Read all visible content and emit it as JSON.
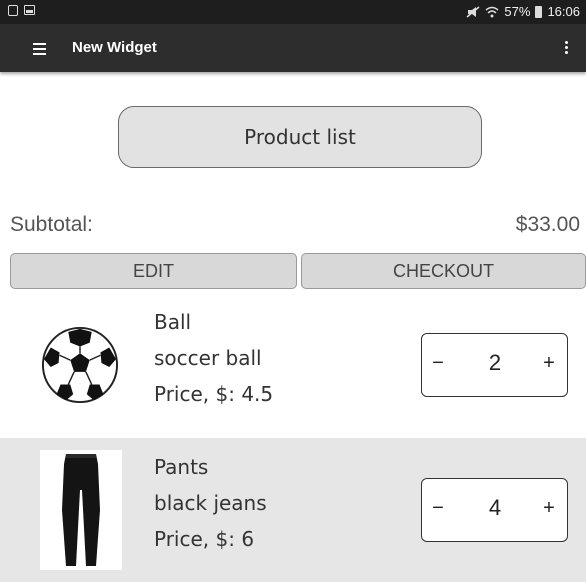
{
  "status_bar": {
    "signal_text": "57%",
    "time": "16:06"
  },
  "toolbar": {
    "title": "New Widget",
    "menu_icon": "hamburger-menu-icon",
    "overflow_icon": "more-vert-icon"
  },
  "main": {
    "product_list_button": "Product list",
    "subtotal_label": "Subtotal:",
    "subtotal_value": "$33.00",
    "edit_button": "EDIT",
    "checkout_button": "CHECKOUT"
  },
  "items": [
    {
      "name": "Ball",
      "description": "soccer ball",
      "price": "Price, $: 4.5",
      "quantity": "2",
      "image_icon": "soccer-ball-image"
    },
    {
      "name": "Pants",
      "description": "black jeans",
      "price": "Price, $: 6",
      "quantity": "4",
      "image_icon": "black-jeans-image"
    }
  ],
  "stepper": {
    "minus": "−",
    "plus": "+"
  },
  "colors": {
    "status_bar": "#1e1e1e",
    "toolbar": "#2d2d2d",
    "alt_row": "#e6e6e6",
    "button": "#d8d8d8"
  }
}
